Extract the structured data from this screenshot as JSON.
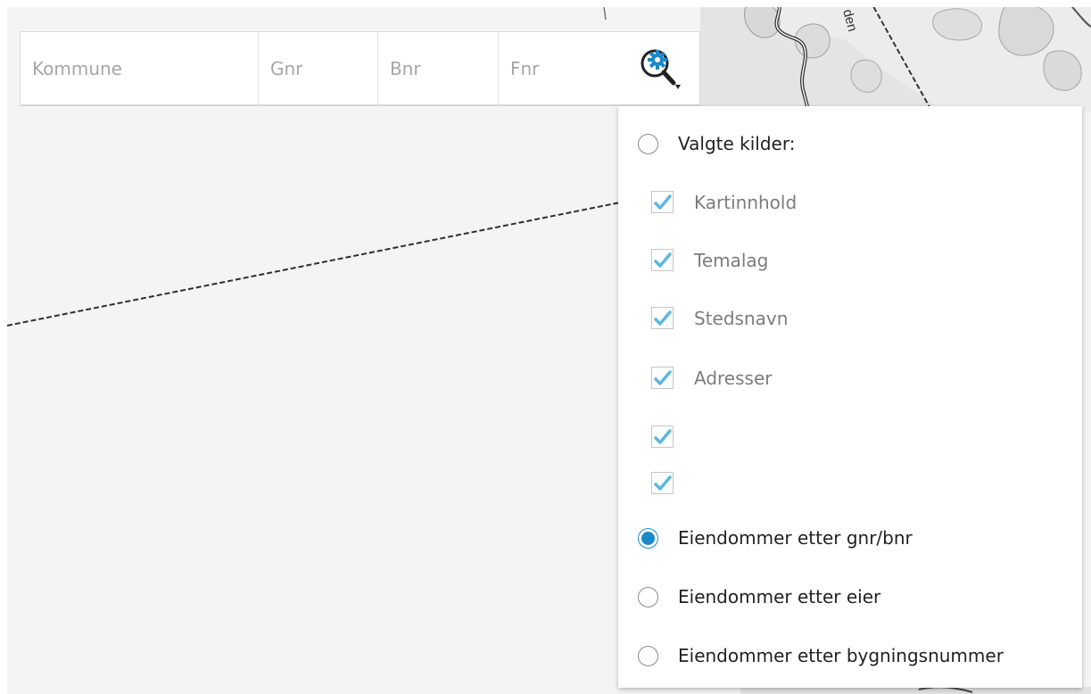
{
  "search": {
    "kommune_placeholder": "Kommune",
    "gnr_placeholder": "Gnr",
    "bnr_placeholder": "Bnr",
    "fnr_placeholder": "Fnr",
    "options_icon": "search-settings-icon"
  },
  "map": {
    "place_label": "den"
  },
  "dropdown": {
    "selected_sources_label": "Valgte kilder:",
    "sources": [
      {
        "label": "Kartinnhold",
        "checked": true
      },
      {
        "label": "Temalag",
        "checked": true
      },
      {
        "label": "Stedsnavn",
        "checked": true
      },
      {
        "label": "Adresser",
        "checked": true
      },
      {
        "label": "",
        "checked": true
      },
      {
        "label": "",
        "checked": true
      }
    ],
    "modes": [
      {
        "label": "Eiendommer etter gnr/bnr",
        "selected": true
      },
      {
        "label": "Eiendommer etter eier",
        "selected": false
      },
      {
        "label": "Eiendommer etter bygningsnummer",
        "selected": false
      }
    ]
  },
  "colors": {
    "accent": "#1a88c9",
    "check": "#5bb8df",
    "placeholder": "#a6a6a6"
  }
}
